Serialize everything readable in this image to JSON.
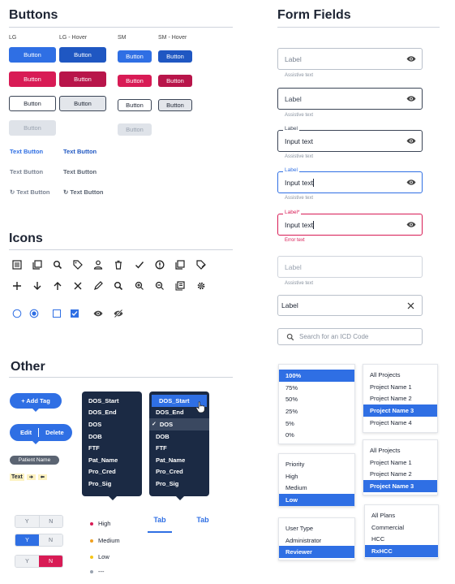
{
  "buttons": {
    "title": "Buttons",
    "col_lg": "LG",
    "col_lg_hover": "LG - Hover",
    "col_sm": "SM",
    "col_sm_hover": "SM - Hover",
    "label": "Button",
    "text_button": "Text Button"
  },
  "icons": {
    "title": "Icons"
  },
  "other": {
    "title": "Other",
    "add_tag": "+ Add Tag",
    "edit": "Edit",
    "delete": "Delete",
    "chip": "Patient Name",
    "tag_text": "Text",
    "menu1": [
      "DOS_Start",
      "DOS_End",
      "DOS",
      "DOB",
      "FTF",
      "Pat_Name",
      "Pro_Cred",
      "Pro_Sig"
    ],
    "menu2": [
      "DOS_Start",
      "DOS_End",
      "DOS",
      "DOB",
      "FTF",
      "Pat_Name",
      "Pro_Cred",
      "Pro_Sig"
    ],
    "check": "✓",
    "yes": "Y",
    "no": "N",
    "priorities": [
      {
        "label": "High",
        "color": "#d81b55"
      },
      {
        "label": "Medium",
        "color": "#f0a020"
      },
      {
        "label": "Low",
        "color": "#f5c518"
      },
      {
        "label": "---",
        "color": "#9aa3b0"
      }
    ],
    "tab1": "Tab",
    "tab2": "Tab"
  },
  "form": {
    "title": "Form Fields",
    "label": "Label",
    "label_req": "Label*",
    "assist": "Assistive text",
    "input": "Input text",
    "error": "Error text",
    "search_placeholder": "Search for an ICD Code"
  },
  "dropdowns": {
    "percent": [
      "100%",
      "75%",
      "50%",
      "25%",
      "5%",
      "0%"
    ],
    "projects_a": [
      "All Projects",
      "Project Name 1",
      "Project Name 2",
      "Project Name 3",
      "Project Name 4"
    ],
    "projects_b": [
      "All Projects",
      "Project Name 1",
      "Project Name 2",
      "Project Name 3"
    ],
    "priority": [
      "Priority",
      "High",
      "Medium",
      "Low"
    ],
    "user_type": [
      "User Type",
      "Administrator",
      "Reviewer"
    ],
    "plans": [
      "All Plans",
      "Commercial",
      "HCC",
      "RxHCC"
    ]
  },
  "colors": {
    "primary": "#2f6fe4",
    "danger": "#d81b55",
    "navy": "#1b2a44"
  }
}
